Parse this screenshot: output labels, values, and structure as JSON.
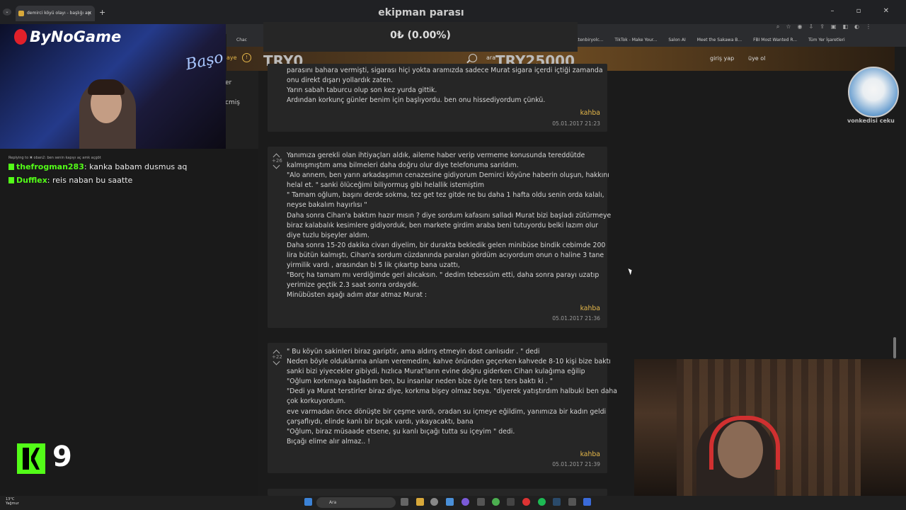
{
  "browser": {
    "tab_title": "demirci köyü olayı - başlığı açı",
    "new_tab": "+",
    "window_controls": "– ▫ ✕",
    "bookmarks": [
      "(1)gelecektenbiryolc...",
      "TikTok - Make Your...",
      "Salon AI",
      "Meet the Sakawa B...",
      "FBI Most Wanted R...",
      "Tüm Yer İşaretleri"
    ],
    "bookmark_left": "Chac"
  },
  "site": {
    "login": "giriş yap",
    "register": "üye ol",
    "nick_partial": "aye",
    "search_partial": "ara",
    "side_items": [
      "er",
      "cmiş"
    ]
  },
  "overlay": {
    "title": "ekipman parası",
    "progress_text": "0₺ (0.00%)",
    "progress_fraction": 0.0,
    "min_label": "TRY0",
    "max_label": "TRY25000",
    "brand": "ByNoGame",
    "neon_text": "Başo",
    "kick_count": "9",
    "channel_label": "vonkedisi ceku"
  },
  "chat": {
    "replying": "Replying to ✖ oban2: ben senin kapıyı aç amk açgöt",
    "messages": [
      {
        "user": "thefrogman283",
        "text": "kanka babam dusmus aq"
      },
      {
        "user": "Dufflex",
        "text": "reis naban bu saatte"
      }
    ]
  },
  "entries": [
    {
      "votes": "",
      "lines": [
        "parasını bahara vermişti, sigarası hiçi yokta aramızda sadece Murat sigara içerdi içtiği zamanda",
        "onu direkt dışarı yollardık zaten.",
        "Yarın sabah taburcu olup son kez yurda gittik.",
        "Ardından korkunç günler benim için başlıyordu. ben onu hissediyordum çünkü."
      ],
      "author": "kahba",
      "date": "05.01.2017 21:23"
    },
    {
      "votes": "+26",
      "lines": [
        "Yanımıza gerekli olan ihtiyaçları aldık, aileme haber verip vermeme konusunda tereddütde",
        "kalmışmıştım ama bilmeleri daha doğru olur diye telefonuma sarıldım.",
        "\"Alo annem, ben yarın arkadaşımın cenazesine gidiyorum Demirci köyüne haberin oluşun, hakkını",
        "helal et. \" sanki ölüceğimi biliyormuş gibi helallik istemiştim",
        "\" Tamam oğlum, başını derde sokma, tez get tez gitde ne bu daha 1 hafta oldu senin orda kalalı,",
        "neyse bakalım hayırlısı \"",
        "Daha sonra Cihan'a baktım hazır mısın ? diye sordum kafasını salladı Murat bizi başladı zütürmeye",
        "biraz kalabalık kesimlere gidiyorduk, ben markete girdim araba beni tutuyordu belki lazım olur",
        "diye tuzlu bişeyler aldım.",
        "Daha sonra 15-20 dakika civarı diyelim, bir durakta bekledik gelen minibüse bindik cebimde 200",
        "lira bütün kalmıştı, Cihan'a sordum cüzdanında paraları gördüm acıyordum onun o haline 3 tane",
        "yirmilik vardı , arasından bi 5 lik çıkartıp bana uzattı,",
        "\"Borç ha tamam mı verdiğimde geri alıcaksın. \" dedim tebessüm etti, daha sonra parayı uzatıp",
        "yerimize geçtik 2.3 saat sonra ordaydık.",
        "Minübüsten aşağı adım atar atmaz Murat :"
      ],
      "author": "kahba",
      "date": "05.01.2017 21:36"
    },
    {
      "votes": "+22",
      "lines": [
        "\" Bu köyün sakinleri biraz gariptir, ama aldırış etmeyin dost canlısıdır . \" dedi",
        "Neden böyle olduklarına anlam veremedim, kahve önünden geçerken kahvede 8-10 kişi bize baktı",
        "sanki bizi yiyecekler gibiydi, hızlıca Murat'ların evine doğru giderken Cihan kulağıma eğilip",
        "\"Oğlum korkmaya başladım ben, bu insanlar neden bize öyle ters ters baktı ki . \"",
        "\"Dedi ya Murat terstirler biraz diye, korkma bişey olmaz beya. \"diyerek yatıştırdım halbuki ben daha",
        "çok korkuyordum.",
        "eve varmadan önce dönüşte bir çeşme vardı, oradan su içmeye eğildim, yanımıza bir kadın geldi",
        "çarşaflıydı, elinde kanlı bir bıçak vardı, yıkayacaktı, bana",
        "\"Oğlum, biraz müsaade etsene, şu kanlı bıçağı tutta su içeyim \" dedi.",
        "Bıçağı elime alır almaz.. !"
      ],
      "author": "kahba",
      "date": "05.01.2017 21:39"
    }
  ],
  "taskbar": {
    "weather_temp": "13°C",
    "weather_desc": "Yağmur",
    "search_placeholder": "Ara"
  },
  "colors": {
    "author": "#e6b84a",
    "kick_green": "#53fc18",
    "entry_bg": "#262626"
  }
}
